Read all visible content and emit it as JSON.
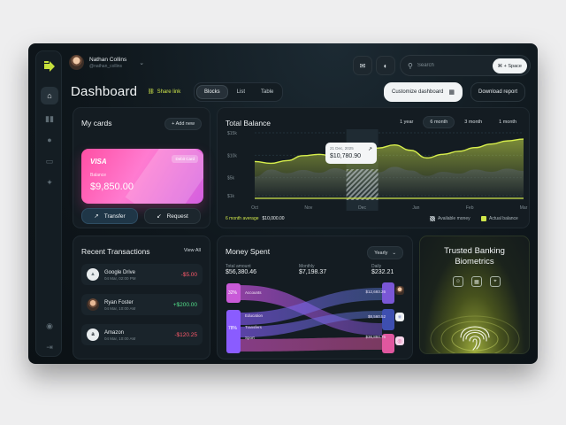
{
  "user": {
    "name": "Nathan Collins",
    "email": "@nathan_collins"
  },
  "search": {
    "placeholder": "Search",
    "shortcut": "⌘ + Space"
  },
  "header": {
    "title": "Dashboard",
    "share_link": "Share link",
    "view_tabs": [
      {
        "label": "Blocks",
        "active": true
      },
      {
        "label": "List",
        "active": false
      },
      {
        "label": "Table",
        "active": false
      }
    ],
    "customize_label": "Customize dashboard",
    "download_label": "Download report"
  },
  "cards": {
    "title": "My cards",
    "add_label": "+ Add new",
    "card": {
      "brand": "VISA",
      "type": "Debit Card",
      "balance_label": "Balance",
      "balance": "$9,850.00"
    },
    "transfer_label": "Transfer",
    "request_label": "Request"
  },
  "total_balance": {
    "title": "Total Balance",
    "ranges": [
      {
        "label": "1 year",
        "active": false
      },
      {
        "label": "6 month",
        "active": true
      },
      {
        "label": "3 month",
        "active": false
      },
      {
        "label": "1 month",
        "active": false
      }
    ],
    "tooltip_date": "21 Dec, 2025",
    "tooltip_value": "$10,780.90",
    "average_label": "6 month average",
    "average_value": "$10,000.00",
    "legend_available": "Available money",
    "legend_actual": "Actual balance"
  },
  "chart_data": {
    "type": "area",
    "categories": [
      "Oct",
      "Nov",
      "Dec",
      "Jan",
      "Feb",
      "Mar"
    ],
    "y_ticks": [
      "$15k",
      "$10k",
      "$5k",
      "$1k"
    ],
    "ylim": [
      0,
      15000
    ],
    "series": [
      {
        "name": "Actual balance",
        "x": [
          0,
          0.3,
          0.6,
          0.9,
          1.2,
          1.5,
          1.8,
          2.0,
          2.3,
          2.6,
          2.9,
          3.2,
          3.5,
          3.8,
          4.1,
          4.4,
          4.7,
          5.0
        ],
        "values": [
          8600,
          8200,
          8800,
          9900,
          10200,
          9700,
          10400,
          10780,
          11600,
          12300,
          11100,
          9400,
          10200,
          10900,
          11700,
          12500,
          13200,
          13600
        ]
      },
      {
        "name": "Available money",
        "x": [
          0,
          0.3,
          0.6,
          0.9,
          1.2,
          1.5,
          1.8,
          2.0,
          2.3,
          2.6,
          2.9,
          3.2,
          3.5,
          3.8,
          4.1,
          4.4,
          4.7,
          5.0
        ],
        "values": [
          5200,
          6800,
          6000,
          6700,
          6100,
          7100,
          6400,
          6900,
          6200,
          7400,
          6600,
          5400,
          6300,
          5900,
          6800,
          6300,
          7000,
          6500
        ]
      }
    ],
    "highlight": {
      "category": "Dec"
    }
  },
  "money_spent": {
    "title": "Money Spent",
    "period": "Yearly",
    "stats": [
      {
        "label": "Total amount",
        "value": "$56,380.46"
      },
      {
        "label": "Monthly",
        "value": "$7,198.37"
      },
      {
        "label": "Daily",
        "value": "$232.21"
      }
    ],
    "left_pct": [
      "32%",
      "78%"
    ],
    "categories": [
      "Accounts",
      "Education",
      "Transfers",
      "Sport"
    ],
    "right_amounts": [
      "$12,693.26",
      "$8,560.52",
      "$36,894.76"
    ]
  },
  "transactions": {
    "title": "Recent Transactions",
    "view_all": "View All",
    "items": [
      {
        "name": "Google Drive",
        "date": "04 Mar, 02:00 PM",
        "amount": "-$5.00",
        "negative": true
      },
      {
        "name": "Ryan Foster",
        "date": "04 Mar, 10:00 AM",
        "amount": "+$200.00",
        "negative": false
      },
      {
        "name": "Amazon",
        "date": "04 Mar, 10:00 AM",
        "amount": "-$120.25",
        "negative": true
      }
    ]
  },
  "biometrics": {
    "title": "Trusted Banking Biometrics"
  },
  "colors": {
    "accent": "#cfe64a",
    "card_pink": "#ff4fa3",
    "negative": "#ff5a6b",
    "positive": "#52e08a"
  }
}
